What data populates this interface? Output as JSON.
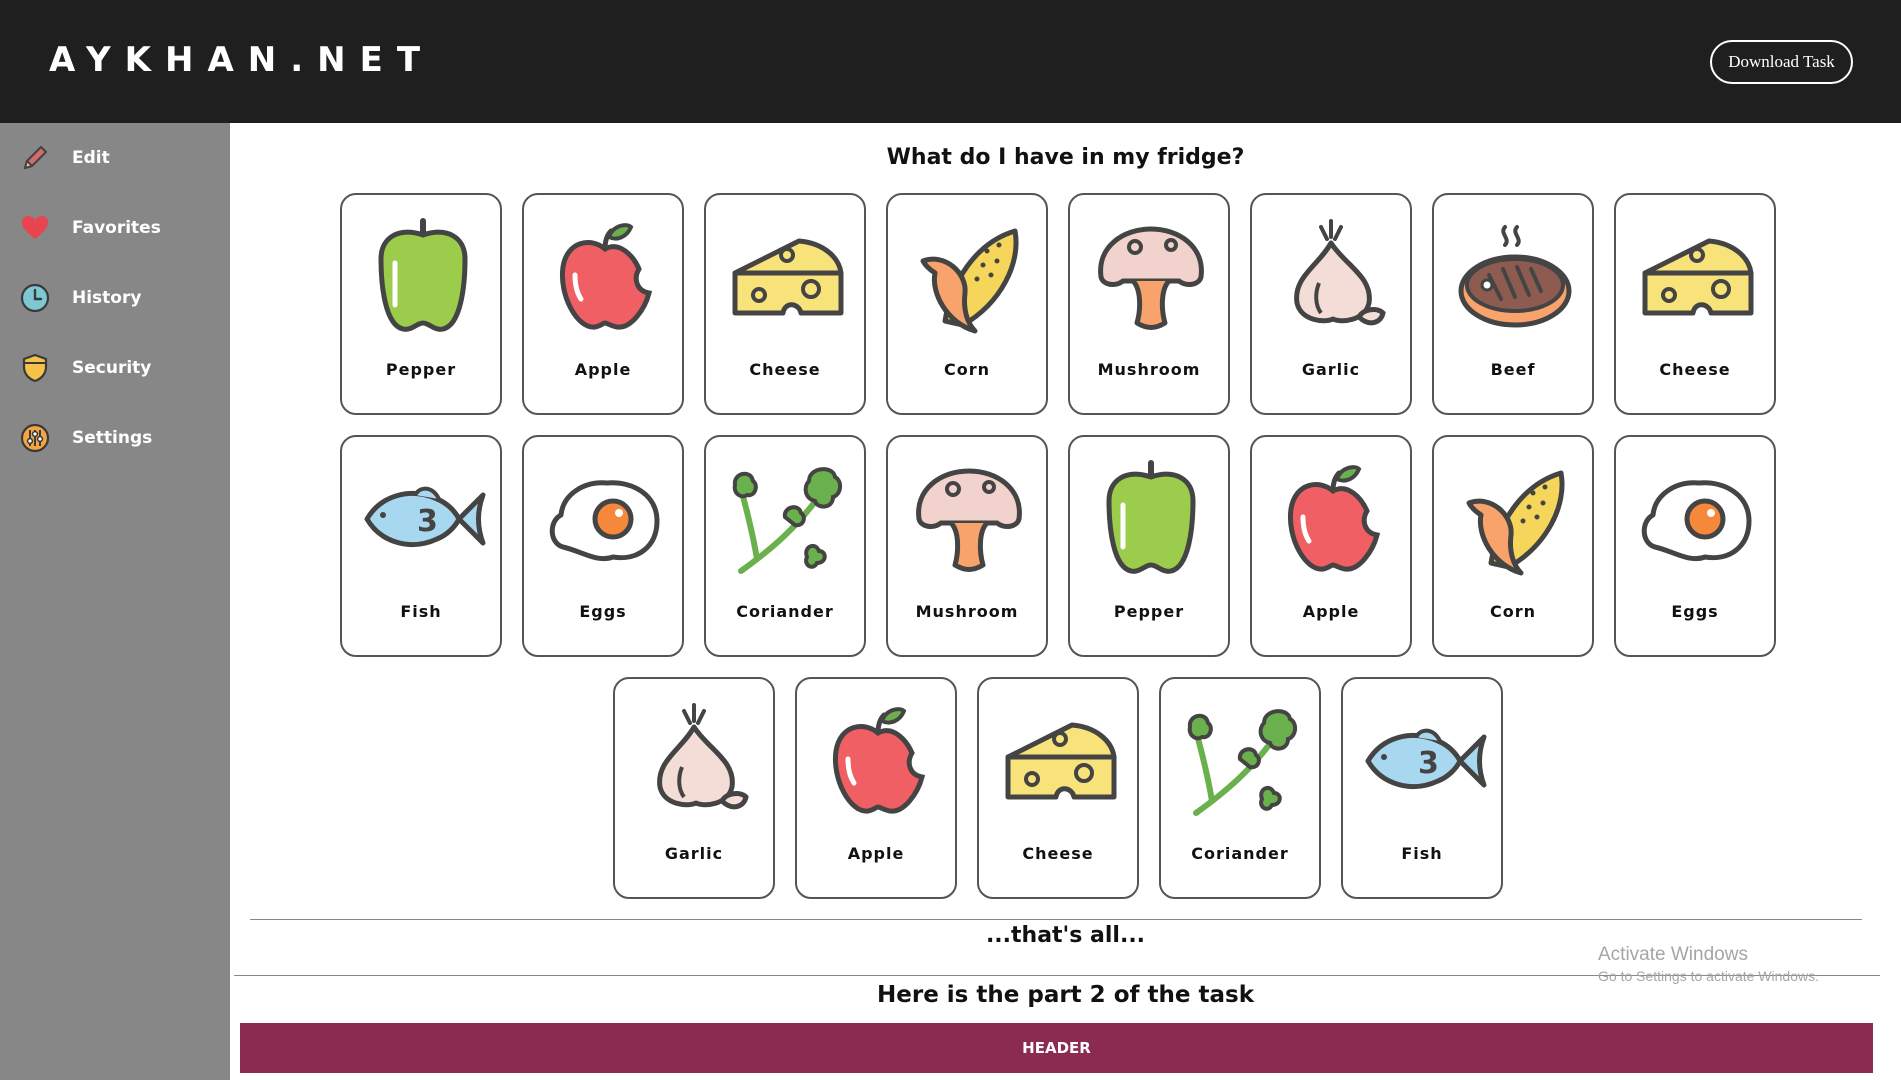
{
  "app": {
    "logo": "AYKHAN.NET",
    "download_label": "Download Task"
  },
  "sidebar": {
    "items": [
      {
        "label": "Edit",
        "icon": "pencil-icon"
      },
      {
        "label": "Favorites",
        "icon": "heart-icon"
      },
      {
        "label": "History",
        "icon": "clock-icon"
      },
      {
        "label": "Security",
        "icon": "shield-icon"
      },
      {
        "label": "Settings",
        "icon": "settings-icon"
      }
    ]
  },
  "main": {
    "title": "What do I have in my fridge?",
    "cards": [
      {
        "label": "Pepper",
        "icon": "pepper-icon"
      },
      {
        "label": "Apple",
        "icon": "apple-icon"
      },
      {
        "label": "Cheese",
        "icon": "cheese-icon"
      },
      {
        "label": "Corn",
        "icon": "corn-icon"
      },
      {
        "label": "Mushroom",
        "icon": "mushroom-icon"
      },
      {
        "label": "Garlic",
        "icon": "garlic-icon"
      },
      {
        "label": "Beef",
        "icon": "beef-icon"
      },
      {
        "label": "Cheese",
        "icon": "cheese-icon"
      },
      {
        "label": "Fish",
        "icon": "fish-icon"
      },
      {
        "label": "Eggs",
        "icon": "egg-icon"
      },
      {
        "label": "Coriander",
        "icon": "coriander-icon"
      },
      {
        "label": "Mushroom",
        "icon": "mushroom-icon"
      },
      {
        "label": "Pepper",
        "icon": "pepper-icon"
      },
      {
        "label": "Apple",
        "icon": "apple-icon"
      },
      {
        "label": "Corn",
        "icon": "corn-icon"
      },
      {
        "label": "Eggs",
        "icon": "egg-icon"
      },
      {
        "label": "Garlic",
        "icon": "garlic-icon"
      },
      {
        "label": "Apple",
        "icon": "apple-icon"
      },
      {
        "label": "Cheese",
        "icon": "cheese-icon"
      },
      {
        "label": "Coriander",
        "icon": "coriander-icon"
      },
      {
        "label": "Fish",
        "icon": "fish-icon"
      }
    ],
    "end_text": "...that's all...",
    "part2_title": "Here is the part 2 of the task",
    "header_label": "HEADER"
  },
  "watermark": {
    "line1": "Activate Windows",
    "line2": "Go to Settings to activate Windows."
  },
  "colors": {
    "topbar": "#1f1f1f",
    "sidebar": "#878787",
    "header_bar": "#8b2b52"
  }
}
